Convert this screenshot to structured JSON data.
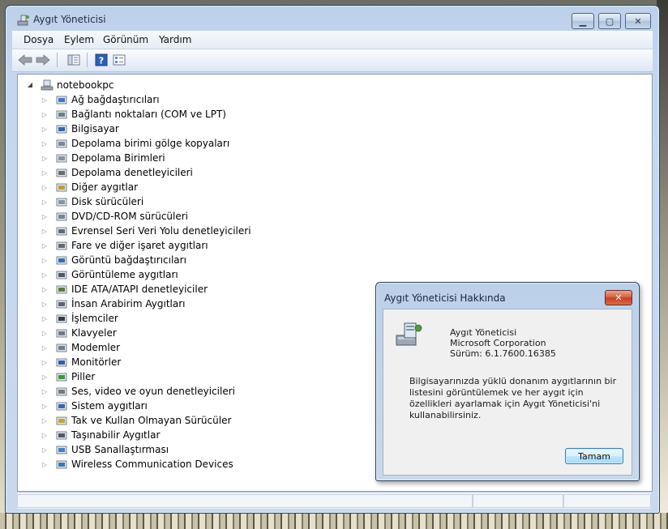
{
  "window": {
    "title": "Aygıt Yöneticisi"
  },
  "menu": [
    "Dosya",
    "Eylem",
    "Görünüm",
    "Yardım"
  ],
  "tree": {
    "root": "notebookpc",
    "items": [
      {
        "label": "Ağ bağdaştırıcıları",
        "icon": "network-adapter-icon"
      },
      {
        "label": "Bağlantı noktaları (COM ve LPT)",
        "icon": "port-icon"
      },
      {
        "label": "Bilgisayar",
        "icon": "computer-icon"
      },
      {
        "label": "Depolama birimi gölge kopyaları",
        "icon": "shadow-copy-icon"
      },
      {
        "label": "Depolama Birimleri",
        "icon": "storage-volume-icon"
      },
      {
        "label": "Depolama denetleyicileri",
        "icon": "storage-controller-icon"
      },
      {
        "label": "Diğer aygıtlar",
        "icon": "unknown-device-icon"
      },
      {
        "label": "Disk sürücüleri",
        "icon": "disk-drive-icon"
      },
      {
        "label": "DVD/CD-ROM sürücüleri",
        "icon": "dvd-drive-icon"
      },
      {
        "label": "Evrensel Seri Veri Yolu denetleyicileri",
        "icon": "usb-controller-icon"
      },
      {
        "label": "Fare ve diğer işaret aygıtları",
        "icon": "mouse-icon"
      },
      {
        "label": "Görüntü bağdaştırıcıları",
        "icon": "display-adapter-icon"
      },
      {
        "label": "Görüntüleme aygıtları",
        "icon": "imaging-device-icon"
      },
      {
        "label": "IDE ATA/ATAPI denetleyiciler",
        "icon": "ide-controller-icon"
      },
      {
        "label": "İnsan Arabirim Aygıtları",
        "icon": "hid-icon"
      },
      {
        "label": "İşlemciler",
        "icon": "processor-icon"
      },
      {
        "label": "Klavyeler",
        "icon": "keyboard-icon"
      },
      {
        "label": "Modemler",
        "icon": "modem-icon"
      },
      {
        "label": "Monitörler",
        "icon": "monitor-icon"
      },
      {
        "label": "Piller",
        "icon": "battery-icon"
      },
      {
        "label": "Ses, video ve oyun denetleyicileri",
        "icon": "sound-icon"
      },
      {
        "label": "Sistem aygıtları",
        "icon": "system-device-icon"
      },
      {
        "label": "Tak ve Kullan Olmayan Sürücüler",
        "icon": "non-pnp-driver-icon"
      },
      {
        "label": "Taşınabilir Aygıtlar",
        "icon": "portable-device-icon"
      },
      {
        "label": "USB Sanallaştırması",
        "icon": "usb-virtualization-icon"
      },
      {
        "label": "Wireless Communication Devices",
        "icon": "wireless-device-icon"
      }
    ]
  },
  "about": {
    "title": "Aygıt Yöneticisi Hakkında",
    "app_name": "Aygıt Yöneticisi",
    "company": "Microsoft Corporation",
    "version": "Sürüm: 6.1.7600.16385",
    "description": "Bilgisayarınızda yüklü donanım aygıtlarının bir listesini görüntülemek ve her aygıt için özellikleri ayarlamak için Aygıt Yöneticisi'ni kullanabilirsiniz.",
    "ok_label": "Tamam",
    "close_glyph": "✕"
  },
  "caption": {
    "minimize": "▁",
    "maximize": "▢",
    "close": "✕"
  },
  "colors": {
    "window_frame": "#c4d7ee",
    "dialog_close": "#c43d22",
    "ok_border": "#3c7fb1"
  }
}
